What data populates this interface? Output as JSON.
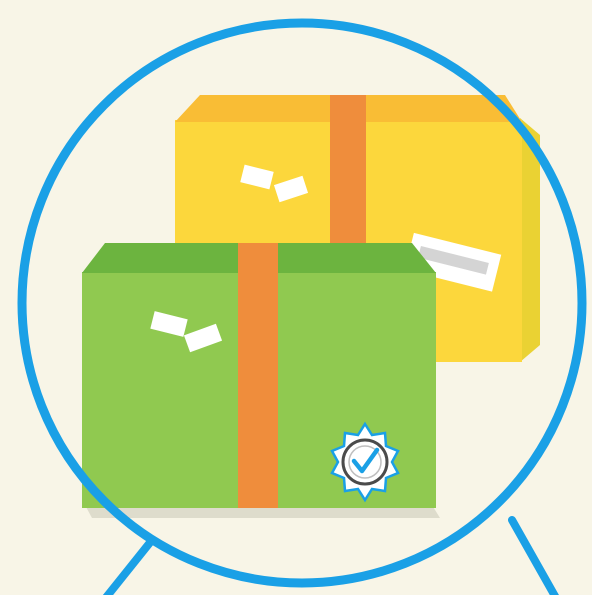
{
  "scene": {
    "background_color": "#f8f5e7",
    "ring_color": "#1aa0e6",
    "back_box": {
      "name": "yellow-package",
      "face_color": "#fcd73c",
      "top_color": "#f9bd35",
      "tape_color": "#ef8d3c",
      "shadow_color": "#ead233"
    },
    "front_box": {
      "name": "green-package",
      "face_color": "#90c950",
      "top_color": "#6cb43f",
      "tape_color": "#ef8d3c",
      "badge_icon": "verified-checkmark-seal-icon",
      "badge_color": "#1aa0e6"
    },
    "label_color": "#ffffff"
  }
}
